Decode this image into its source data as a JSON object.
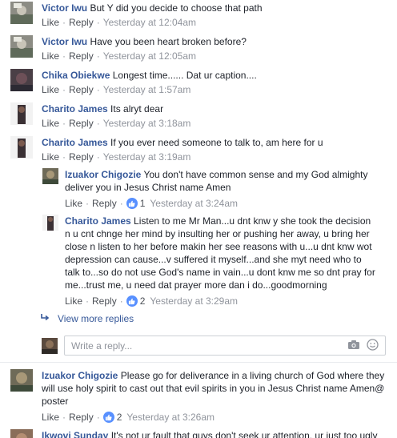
{
  "actions": {
    "like": "Like",
    "reply": "Reply"
  },
  "comments": [
    {
      "author": "Victor Iwu",
      "text": "But Y did you decide to choose that path",
      "time": "Yesterday at 12:04am"
    },
    {
      "author": "Victor Iwu",
      "text": "Have you been heart broken before?",
      "time": "Yesterday at 12:05am"
    },
    {
      "author": "Chika Obiekwe",
      "text": "Longest time...... Dat ur caption....",
      "time": "Yesterday at 1:57am"
    },
    {
      "author": "Charito James",
      "text": "Its alryt dear",
      "time": "Yesterday at 3:18am"
    },
    {
      "author": "Charito James",
      "text": "If you ever need someone to talk to, am here for u",
      "time": "Yesterday at 3:19am"
    }
  ],
  "replies": [
    {
      "author": "Izuakor Chigozie",
      "line1": "You don't have common sense and my God almighty",
      "line2": "deliver you in Jesus Christ name Amen",
      "likes": "1",
      "time": "Yesterday at 3:24am"
    },
    {
      "author": "Charito James",
      "lines": [
        "Listen to me Mr Man...u dnt knw y she took the decision",
        "n u cnt chnge her mind by insulting her or pushing her away, u bring her",
        "close n listen to her before makin her see reasons with u...u dnt knw wot",
        "depression can cause...v suffered it myself...and she myt need who to",
        "talk to...so do not use God's name in vain...u dont knw me so dnt pray for",
        "me...trust me, u need dat prayer more dan i do...goodmorning"
      ],
      "likes": "2",
      "time": "Yesterday at 3:29am"
    }
  ],
  "view_more": "View more replies",
  "reply_input": {
    "placeholder": "Write a reply..."
  },
  "bottom_comment": {
    "author": "Izuakor Chigozie",
    "lines": [
      "Please go for deliverance in a living church of God where they",
      "will use holy spirit to cast out that evil spirits in you in Jesus Christ name Amen@",
      "poster"
    ],
    "likes": "2",
    "time": "Yesterday at 3:26am"
  },
  "cut_comment": {
    "author": "Ikwovi Sunday",
    "text": "It's not ur fault that guys don't seek ur attention, ur just too ugly"
  },
  "colors": {
    "link": "#365899",
    "meta": "#90949c",
    "like_badge": "#5890ff"
  },
  "icons": [
    "thumbs-up-icon",
    "reply-arrow-icon",
    "camera-icon",
    "emoji-icon"
  ]
}
